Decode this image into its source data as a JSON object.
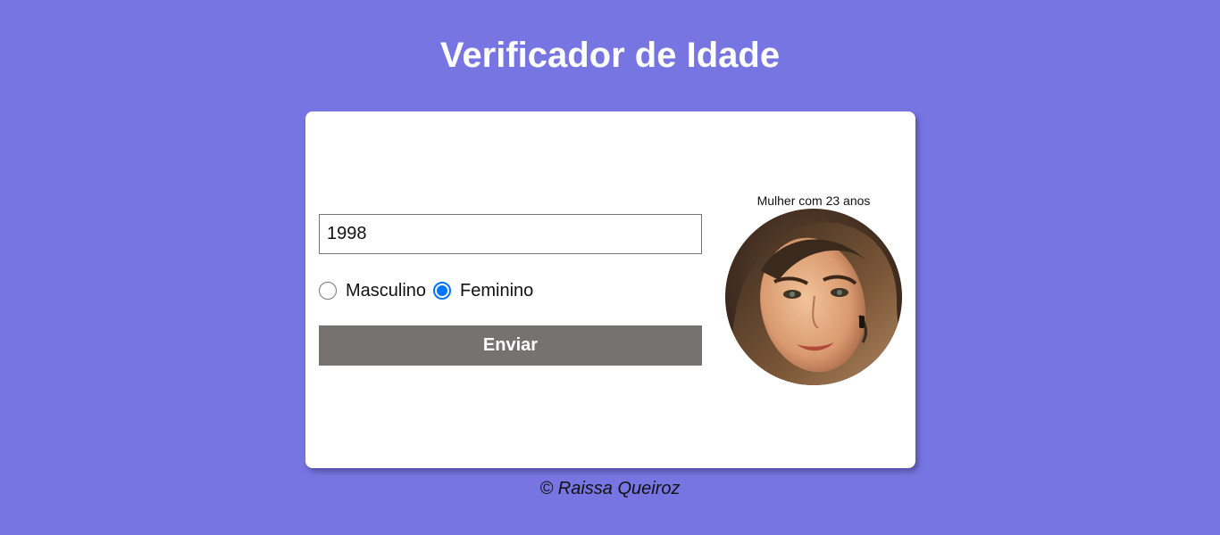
{
  "header": {
    "title": "Verificador de Idade"
  },
  "form": {
    "year_value": "1998",
    "sex_options": [
      {
        "label": "Masculino",
        "selected": false
      },
      {
        "label": "Feminino",
        "selected": true
      }
    ],
    "submit_label": "Enviar"
  },
  "result": {
    "text": "Mulher com 23 anos",
    "image": "woman-portrait-photo"
  },
  "footer": {
    "text": "© Raissa Queiroz"
  },
  "colors": {
    "background": "#7775e1",
    "card": "#ffffff",
    "button": "#767271",
    "radio_accent": "#0075ff"
  }
}
